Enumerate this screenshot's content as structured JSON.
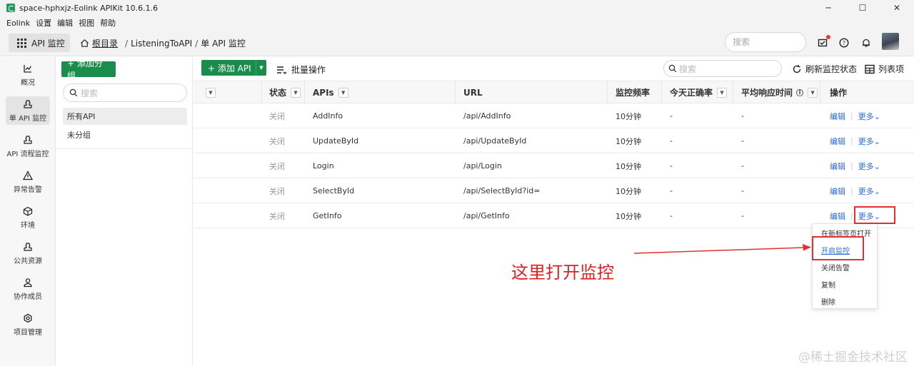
{
  "window": {
    "title": "space-hphxjz-Eolink APIKit 10.6.1.6",
    "minimize": "─",
    "maximize": "☐",
    "close": "✕"
  },
  "menu": [
    "Eolink",
    "设置",
    "编辑",
    "视图",
    "帮助"
  ],
  "header": {
    "module_label": "API 监控",
    "breadcrumb": {
      "root": "根目录",
      "sep": "/",
      "project": "ListeningToAPI",
      "current": "单 API 监控"
    },
    "search_placeholder": "搜索"
  },
  "leftnav": [
    {
      "label": "概况",
      "icon": "chart-icon"
    },
    {
      "label": "单 API 监控",
      "icon": "puzzle-icon"
    },
    {
      "label": "API 流程监控",
      "icon": "puzzle-icon"
    },
    {
      "label": "异常告警",
      "icon": "warning-icon"
    },
    {
      "label": "环境",
      "icon": "cube-icon"
    },
    {
      "label": "公共资源",
      "icon": "puzzle-icon"
    },
    {
      "label": "协作成员",
      "icon": "user-icon"
    },
    {
      "label": "项目管理",
      "icon": "gear-icon"
    }
  ],
  "groups": {
    "add_label": "+ 添加分组",
    "search_placeholder": "搜索",
    "items": [
      "所有API",
      "未分组"
    ]
  },
  "toolbar": {
    "add_api": "+ 添加 API",
    "batch": "批量操作",
    "search_placeholder": "搜索",
    "refresh": "刷新监控状态",
    "columns": "列表项"
  },
  "table": {
    "headers": {
      "status": "状态",
      "apis": "APIs",
      "url": "URL",
      "freq": "监控频率",
      "accuracy": "今天正确率",
      "resp": "平均响应时间",
      "ops": "操作"
    },
    "rows": [
      {
        "status": "关闭",
        "name": "AddInfo",
        "url": "/api/AddInfo",
        "freq": "10分钟",
        "accuracy": "-",
        "resp": "-"
      },
      {
        "status": "关闭",
        "name": "UpdateById",
        "url": "/api/UpdateById",
        "freq": "10分钟",
        "accuracy": "-",
        "resp": "-"
      },
      {
        "status": "关闭",
        "name": "Login",
        "url": "/api/Login",
        "freq": "10分钟",
        "accuracy": "-",
        "resp": "-"
      },
      {
        "status": "关闭",
        "name": "SelectById",
        "url": "/api/SelectById?id=",
        "freq": "10分钟",
        "accuracy": "-",
        "resp": "-"
      },
      {
        "status": "关闭",
        "name": "GetInfo",
        "url": "/api/GetInfo",
        "freq": "10分钟",
        "accuracy": "-",
        "resp": "-"
      }
    ],
    "edit_label": "编辑",
    "more_label": "更多"
  },
  "dropdown": [
    "在新标签页打开",
    "开启监控",
    "关闭告警",
    "复制",
    "删除"
  ],
  "annotation": "这里打开监控",
  "watermark": "@稀土掘金技术社区",
  "colors": {
    "primary": "#1a8d4c",
    "link": "#2a6ad8",
    "annotation": "#e03030"
  }
}
